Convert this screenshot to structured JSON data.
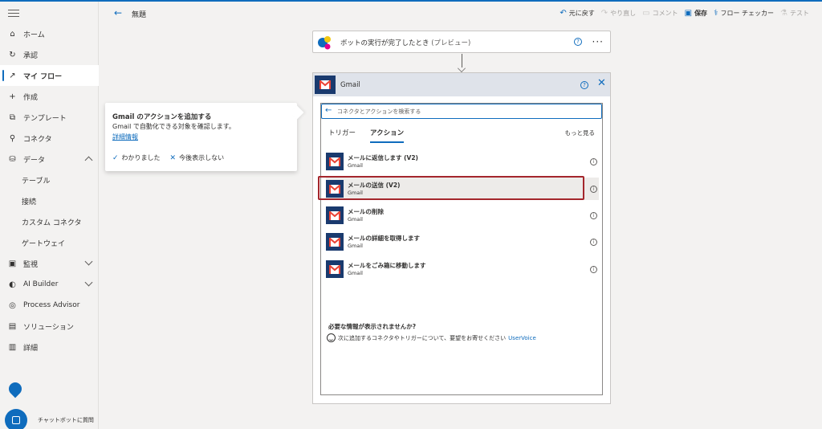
{
  "header": {
    "flow_title": "無題",
    "toolbar": [
      {
        "label": "元に戻す",
        "icon": "undo-icon",
        "enabled": true
      },
      {
        "label": "やり直し",
        "icon": "redo-icon",
        "enabled": false
      },
      {
        "label": "コメント",
        "icon": "comment-icon",
        "enabled": false
      },
      {
        "label": "保存",
        "icon": "save-icon",
        "enabled": true
      },
      {
        "label": "フロー チェッカー",
        "icon": "stethoscope-icon",
        "enabled": true
      },
      {
        "label": "テスト",
        "icon": "beaker-icon",
        "enabled": false
      }
    ]
  },
  "sidebar": {
    "items": [
      {
        "label": "ホーム",
        "icon": "home-icon"
      },
      {
        "label": "承認",
        "icon": "approvals-icon"
      },
      {
        "label": "マイ フロー",
        "icon": "flow-icon",
        "active": true
      },
      {
        "label": "作成",
        "icon": "plus-icon"
      },
      {
        "label": "テンプレート",
        "icon": "template-icon"
      },
      {
        "label": "コネクタ",
        "icon": "connector-icon"
      },
      {
        "label": "データ",
        "icon": "database-icon",
        "expanded": true
      },
      {
        "label": "テーブル",
        "sub": true
      },
      {
        "label": "接続",
        "sub": true
      },
      {
        "label": "カスタム コネクタ",
        "sub": true
      },
      {
        "label": "ゲートウェイ",
        "sub": true
      },
      {
        "label": "監視",
        "icon": "monitor-icon",
        "collapsed": true
      },
      {
        "label": "AI Builder",
        "icon": "ai-builder-icon",
        "collapsed": true
      },
      {
        "label": "Process Advisor",
        "icon": "process-advisor-icon"
      },
      {
        "label": "ソリューション",
        "icon": "solutions-icon"
      },
      {
        "label": "詳細",
        "icon": "learn-icon"
      }
    ],
    "chatbot_label": "チャットボットに質問"
  },
  "trigger": {
    "title": "ボットの実行が完了したとき",
    "suffix": "(プレビュー)"
  },
  "panel": {
    "title": "Gmail",
    "search_placeholder": "コネクタとアクションを検索する",
    "tabs": [
      {
        "label": "トリガー",
        "active": false
      },
      {
        "label": "アクション",
        "active": true
      }
    ],
    "see_more": "もっと見る",
    "actions": [
      {
        "title": "メールに返信します (V2)",
        "connector": "Gmail",
        "selected": false
      },
      {
        "title": "メールの送信 (V2)",
        "connector": "Gmail",
        "selected": true
      },
      {
        "title": "メールの削除",
        "connector": "Gmail",
        "selected": false
      },
      {
        "title": "メールの詳細を取得します",
        "connector": "Gmail",
        "selected": false
      },
      {
        "title": "メールをごみ箱に移動します",
        "connector": "Gmail",
        "selected": false
      }
    ],
    "missing_title": "必要な情報が表示されませんか?",
    "feedback_text": "次に追加するコネクタやトリガーについて、要望をお寄せください",
    "feedback_link": "UserVoice"
  },
  "callout": {
    "title": "Gmail のアクションを追加する",
    "body": "Gmail で自動化できる対象を確認します。",
    "link": "詳細情報",
    "ok": "わかりました",
    "dismiss": "今後表示しない"
  },
  "colors": {
    "accent": "#0f6cbd",
    "gmail_badge": "#1a3a6e",
    "gmail_red": "#ea4335",
    "highlight": "#a4262c"
  }
}
